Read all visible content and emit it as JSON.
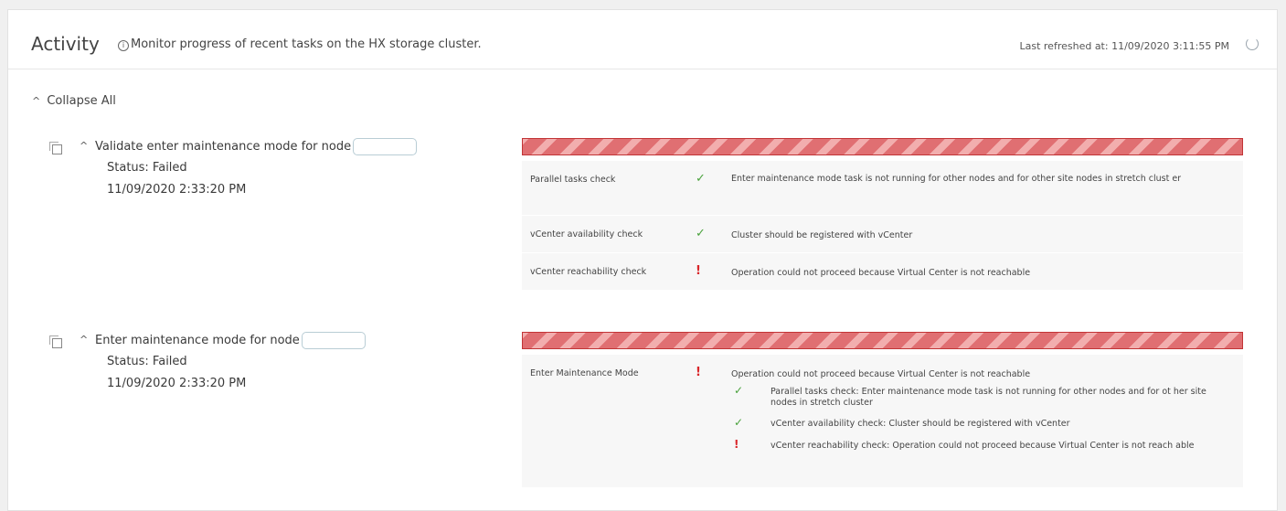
{
  "header": {
    "title": "Activity",
    "info_icon": "info-icon",
    "subtitle": "Monitor progress of recent tasks on the HX storage cluster.",
    "last_refreshed": "Last refreshed at: 11/09/2020 3:11:55 PM",
    "refresh_icon": "refresh-icon"
  },
  "collapse_all": "Collapse All",
  "tasks": [
    {
      "name": "Validate enter maintenance mode for node",
      "status": "Status: Failed",
      "time": "11/09/2020 2:33:20 PM",
      "progress_state": "failed",
      "checks": [
        {
          "name": "Parallel tasks check",
          "result": "ok",
          "message": "Enter maintenance mode task is not running for other nodes and for other site nodes in stretch clust er"
        },
        {
          "name": "vCenter availability check",
          "result": "ok",
          "message": "Cluster should be registered with vCenter"
        },
        {
          "name": "vCenter reachability check",
          "result": "fail",
          "message": "Operation could not proceed because Virtual Center is not reachable"
        }
      ]
    },
    {
      "name": "Enter maintenance mode for node",
      "status": "Status: Failed",
      "time": "11/09/2020 2:33:20 PM",
      "progress_state": "failed",
      "checks": [
        {
          "name": "Enter Maintenance Mode",
          "result": "fail",
          "message": "Operation could not proceed because Virtual Center is not reachable",
          "subchecks": [
            {
              "result": "ok",
              "message": "Parallel tasks check: Enter maintenance mode task is not running for other nodes and for ot her site nodes in stretch cluster"
            },
            {
              "result": "ok",
              "message": "vCenter availability check: Cluster should be registered with vCenter"
            },
            {
              "result": "fail",
              "message": "vCenter reachability check: Operation could not proceed because Virtual Center is not reach able"
            }
          ]
        }
      ]
    }
  ],
  "icons": {
    "ok": "✓",
    "fail": "!"
  },
  "colors": {
    "ok": "#4aa23d",
    "fail": "#d9262a",
    "bar_border": "#c23436",
    "bar_fill": "#e06f72"
  }
}
